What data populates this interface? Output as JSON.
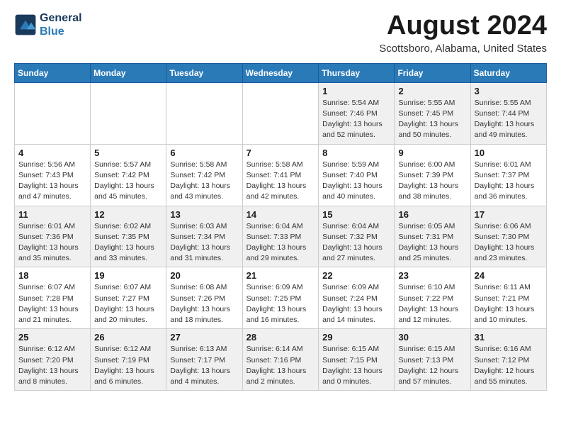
{
  "header": {
    "logo_line1": "General",
    "logo_line2": "Blue",
    "title": "August 2024",
    "subtitle": "Scottsboro, Alabama, United States"
  },
  "calendar": {
    "days_of_week": [
      "Sunday",
      "Monday",
      "Tuesday",
      "Wednesday",
      "Thursday",
      "Friday",
      "Saturday"
    ],
    "weeks": [
      [
        {
          "day": "",
          "info": ""
        },
        {
          "day": "",
          "info": ""
        },
        {
          "day": "",
          "info": ""
        },
        {
          "day": "",
          "info": ""
        },
        {
          "day": "1",
          "info": "Sunrise: 5:54 AM\nSunset: 7:46 PM\nDaylight: 13 hours\nand 52 minutes."
        },
        {
          "day": "2",
          "info": "Sunrise: 5:55 AM\nSunset: 7:45 PM\nDaylight: 13 hours\nand 50 minutes."
        },
        {
          "day": "3",
          "info": "Sunrise: 5:55 AM\nSunset: 7:44 PM\nDaylight: 13 hours\nand 49 minutes."
        }
      ],
      [
        {
          "day": "4",
          "info": "Sunrise: 5:56 AM\nSunset: 7:43 PM\nDaylight: 13 hours\nand 47 minutes."
        },
        {
          "day": "5",
          "info": "Sunrise: 5:57 AM\nSunset: 7:42 PM\nDaylight: 13 hours\nand 45 minutes."
        },
        {
          "day": "6",
          "info": "Sunrise: 5:58 AM\nSunset: 7:42 PM\nDaylight: 13 hours\nand 43 minutes."
        },
        {
          "day": "7",
          "info": "Sunrise: 5:58 AM\nSunset: 7:41 PM\nDaylight: 13 hours\nand 42 minutes."
        },
        {
          "day": "8",
          "info": "Sunrise: 5:59 AM\nSunset: 7:40 PM\nDaylight: 13 hours\nand 40 minutes."
        },
        {
          "day": "9",
          "info": "Sunrise: 6:00 AM\nSunset: 7:39 PM\nDaylight: 13 hours\nand 38 minutes."
        },
        {
          "day": "10",
          "info": "Sunrise: 6:01 AM\nSunset: 7:37 PM\nDaylight: 13 hours\nand 36 minutes."
        }
      ],
      [
        {
          "day": "11",
          "info": "Sunrise: 6:01 AM\nSunset: 7:36 PM\nDaylight: 13 hours\nand 35 minutes."
        },
        {
          "day": "12",
          "info": "Sunrise: 6:02 AM\nSunset: 7:35 PM\nDaylight: 13 hours\nand 33 minutes."
        },
        {
          "day": "13",
          "info": "Sunrise: 6:03 AM\nSunset: 7:34 PM\nDaylight: 13 hours\nand 31 minutes."
        },
        {
          "day": "14",
          "info": "Sunrise: 6:04 AM\nSunset: 7:33 PM\nDaylight: 13 hours\nand 29 minutes."
        },
        {
          "day": "15",
          "info": "Sunrise: 6:04 AM\nSunset: 7:32 PM\nDaylight: 13 hours\nand 27 minutes."
        },
        {
          "day": "16",
          "info": "Sunrise: 6:05 AM\nSunset: 7:31 PM\nDaylight: 13 hours\nand 25 minutes."
        },
        {
          "day": "17",
          "info": "Sunrise: 6:06 AM\nSunset: 7:30 PM\nDaylight: 13 hours\nand 23 minutes."
        }
      ],
      [
        {
          "day": "18",
          "info": "Sunrise: 6:07 AM\nSunset: 7:28 PM\nDaylight: 13 hours\nand 21 minutes."
        },
        {
          "day": "19",
          "info": "Sunrise: 6:07 AM\nSunset: 7:27 PM\nDaylight: 13 hours\nand 20 minutes."
        },
        {
          "day": "20",
          "info": "Sunrise: 6:08 AM\nSunset: 7:26 PM\nDaylight: 13 hours\nand 18 minutes."
        },
        {
          "day": "21",
          "info": "Sunrise: 6:09 AM\nSunset: 7:25 PM\nDaylight: 13 hours\nand 16 minutes."
        },
        {
          "day": "22",
          "info": "Sunrise: 6:09 AM\nSunset: 7:24 PM\nDaylight: 13 hours\nand 14 minutes."
        },
        {
          "day": "23",
          "info": "Sunrise: 6:10 AM\nSunset: 7:22 PM\nDaylight: 13 hours\nand 12 minutes."
        },
        {
          "day": "24",
          "info": "Sunrise: 6:11 AM\nSunset: 7:21 PM\nDaylight: 13 hours\nand 10 minutes."
        }
      ],
      [
        {
          "day": "25",
          "info": "Sunrise: 6:12 AM\nSunset: 7:20 PM\nDaylight: 13 hours\nand 8 minutes."
        },
        {
          "day": "26",
          "info": "Sunrise: 6:12 AM\nSunset: 7:19 PM\nDaylight: 13 hours\nand 6 minutes."
        },
        {
          "day": "27",
          "info": "Sunrise: 6:13 AM\nSunset: 7:17 PM\nDaylight: 13 hours\nand 4 minutes."
        },
        {
          "day": "28",
          "info": "Sunrise: 6:14 AM\nSunset: 7:16 PM\nDaylight: 13 hours\nand 2 minutes."
        },
        {
          "day": "29",
          "info": "Sunrise: 6:15 AM\nSunset: 7:15 PM\nDaylight: 13 hours\nand 0 minutes."
        },
        {
          "day": "30",
          "info": "Sunrise: 6:15 AM\nSunset: 7:13 PM\nDaylight: 12 hours\nand 57 minutes."
        },
        {
          "day": "31",
          "info": "Sunrise: 6:16 AM\nSunset: 7:12 PM\nDaylight: 12 hours\nand 55 minutes."
        }
      ]
    ]
  }
}
